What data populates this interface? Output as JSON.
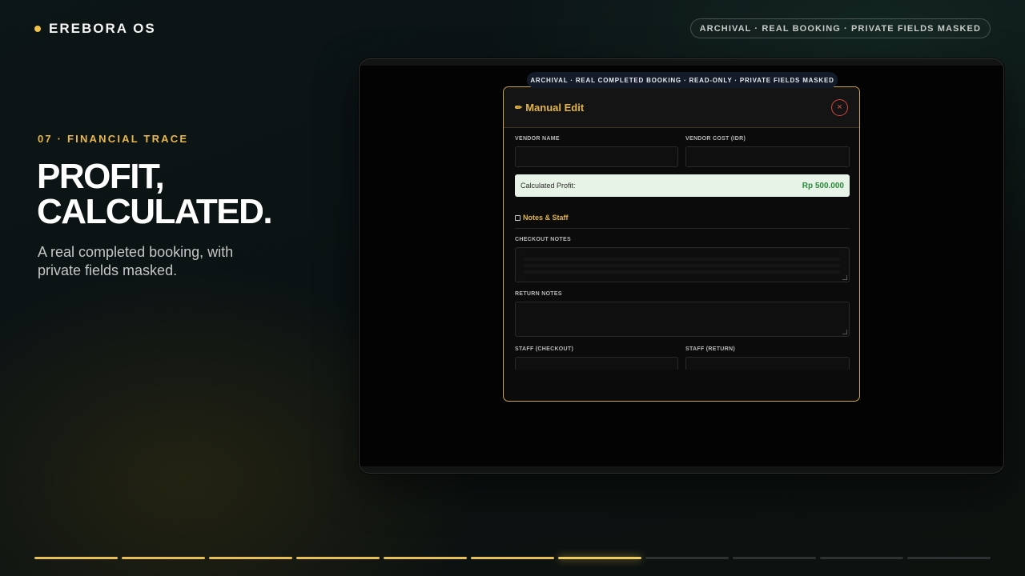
{
  "brand": {
    "name": "EREBORA OS"
  },
  "top_pill": "ARCHIVAL · REAL BOOKING · PRIVATE FIELDS MASKED",
  "slide": {
    "eyebrow": "07 · FINANCIAL TRACE",
    "headline_1": "PROFIT,",
    "headline_2": "CALCULATED.",
    "subline": "A real completed booking, with private fields masked."
  },
  "device": {
    "archival_pill": "ARCHIVAL · REAL COMPLETED BOOKING · READ-ONLY · PRIVATE FIELDS MASKED",
    "modal": {
      "title_icon": "✏",
      "title": "Manual Edit",
      "close_glyph": "×",
      "vendor_name_label": "VENDOR NAME",
      "vendor_name_value": "",
      "vendor_cost_label": "VENDOR COST (IDR)",
      "vendor_cost_value": "",
      "profit_label": "Calculated Profit:",
      "profit_value": "Rp 500.000",
      "section_title": "Notes & Staff",
      "checkout_notes_label": "CHECKOUT NOTES",
      "return_notes_label": "RETURN NOTES",
      "staff_checkout_label": "STAFF (CHECKOUT)",
      "staff_return_label": "STAFF (RETURN)"
    }
  },
  "progress": {
    "total": 11,
    "completed": 6,
    "active_index": 7
  },
  "colors": {
    "accent": "#e8bf52",
    "profit_green": "#2a8a3a",
    "close_red": "#d2453e"
  }
}
